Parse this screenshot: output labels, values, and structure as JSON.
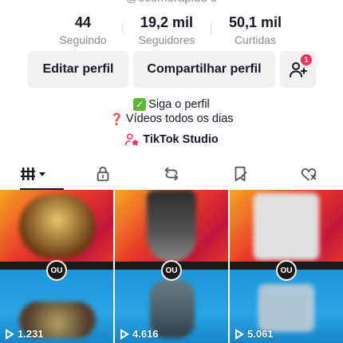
{
  "profile": {
    "username_partial": "@ocomerapidu o"
  },
  "stats": [
    {
      "value": "44",
      "label": "Seguindo"
    },
    {
      "value": "19,2 mil",
      "label": "Seguidores"
    },
    {
      "value": "50,1 mil",
      "label": "Curtidas"
    }
  ],
  "actions": {
    "edit_label": "Editar perfil",
    "share_label": "Compartilhar perfil",
    "add_friend_badge": "1"
  },
  "bio": {
    "line1": "Siga o perfil",
    "line2": "Vídeos todos os dias"
  },
  "studio_label": "TikTok Studio",
  "tabs": [
    {
      "icon": "grid-icon",
      "active": true
    },
    {
      "icon": "lock-icon"
    },
    {
      "icon": "repost-icon"
    },
    {
      "icon": "bookmark-icon"
    },
    {
      "icon": "liked-heart-icon"
    }
  ],
  "videos": [
    {
      "views": "1.231"
    },
    {
      "views": "4.616"
    },
    {
      "views": "5.061"
    }
  ],
  "colors": {
    "accent": "#fe2c55",
    "text_primary": "#161823",
    "text_secondary": "#8a8b91",
    "button_bg": "#f1f1f2"
  }
}
